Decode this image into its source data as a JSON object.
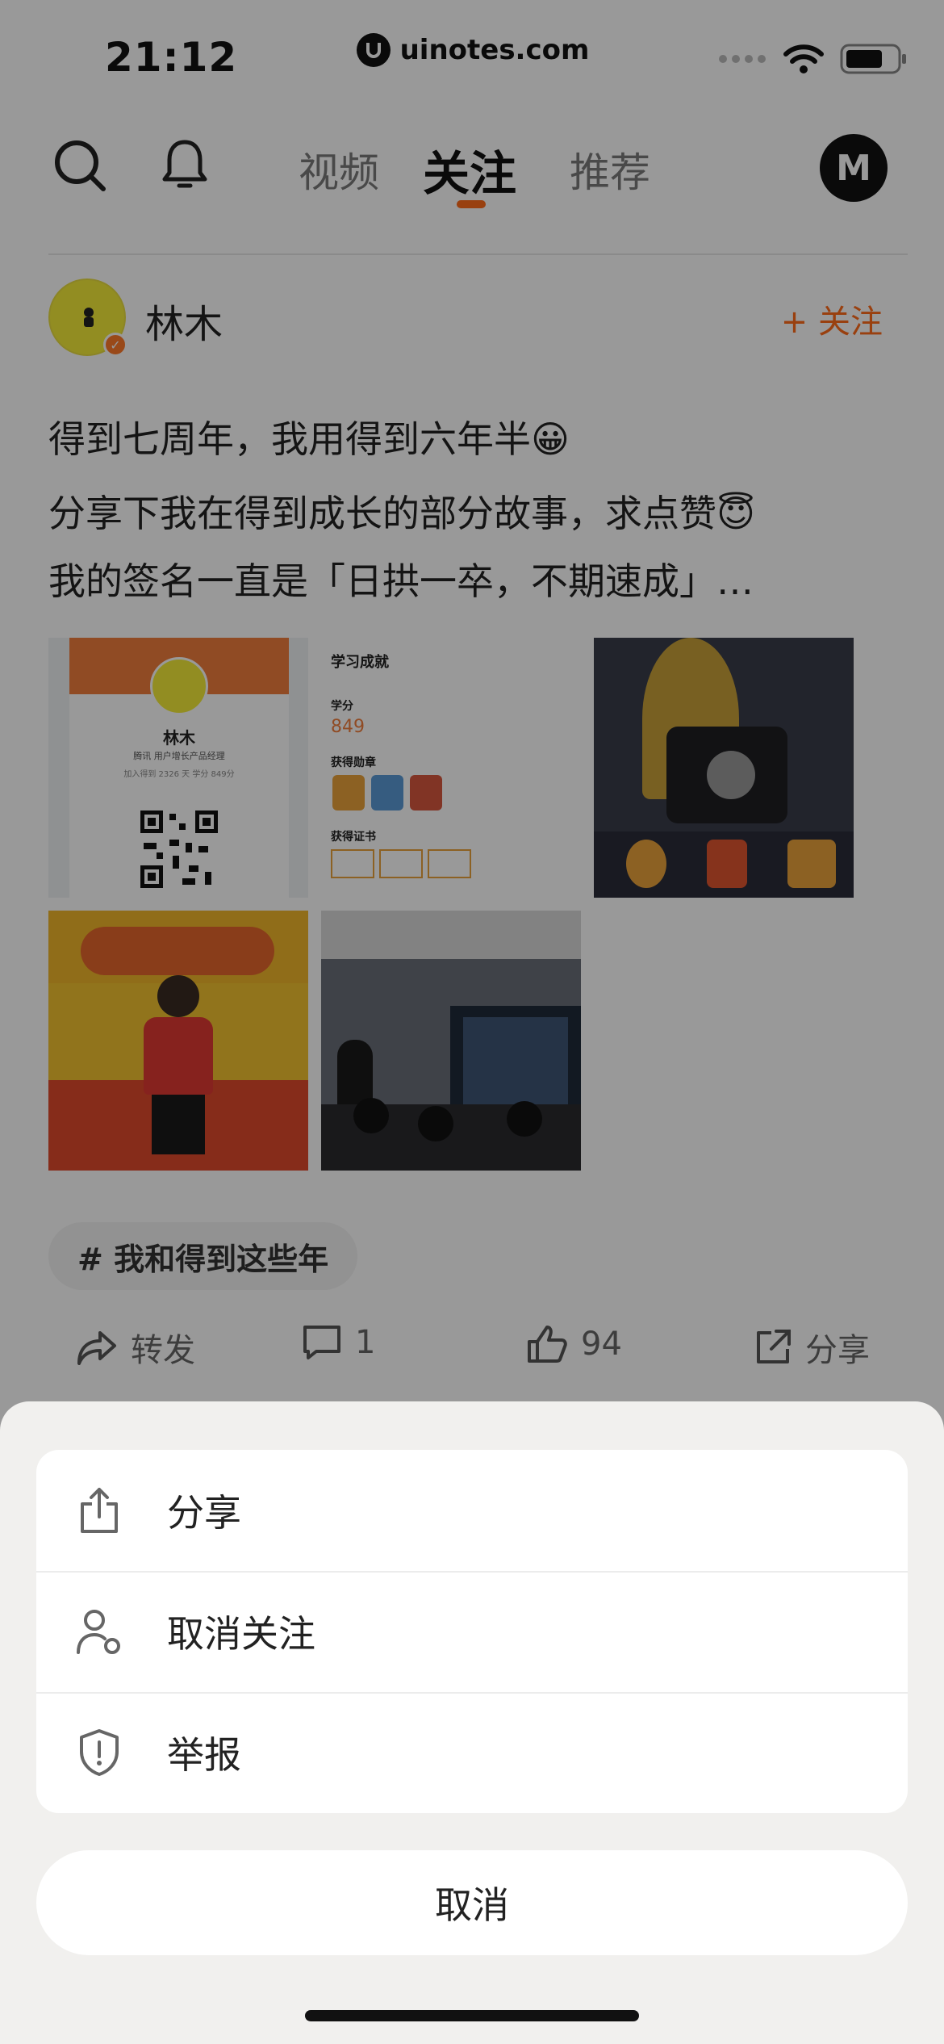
{
  "status_bar": {
    "time": "21:12",
    "url": "uinotes.com"
  },
  "nav": {
    "tabs": [
      "视频",
      "关注",
      "推荐"
    ],
    "active_tab": "关注",
    "avatar_letter": "M"
  },
  "post": {
    "author": "林木",
    "follow_label": "+ 关注",
    "lines": [
      "得到七周年，我用得到六年半😀",
      "分享下我在得到成长的部分故事，求点赞😇",
      "我的签名一直是「日拱一卒，不期速成」…"
    ],
    "card_profile": {
      "name": "林木",
      "role": "腾讯 用户增长产品经理",
      "stats": "加入得到 2326 天   学分 849分"
    },
    "card_achievements": {
      "title": "学习成就",
      "score_label": "学分",
      "score": "849",
      "medals_label": "获得勋章",
      "certs_label": "获得证书"
    },
    "topic": "# 我和得到这些年",
    "actions": {
      "repost": "转发",
      "comments": "1",
      "likes": "94",
      "share": "分享"
    }
  },
  "sheet": {
    "items": [
      {
        "label": "分享",
        "icon": "share-icon"
      },
      {
        "label": "取消关注",
        "icon": "unfollow-user-icon"
      },
      {
        "label": "举报",
        "icon": "shield-report-icon"
      }
    ],
    "cancel": "取消"
  },
  "colors": {
    "accent": "#ff6b1a",
    "overlay": "rgba(0,0,0,0.40)",
    "sheet_bg": "#f1f0ee"
  }
}
